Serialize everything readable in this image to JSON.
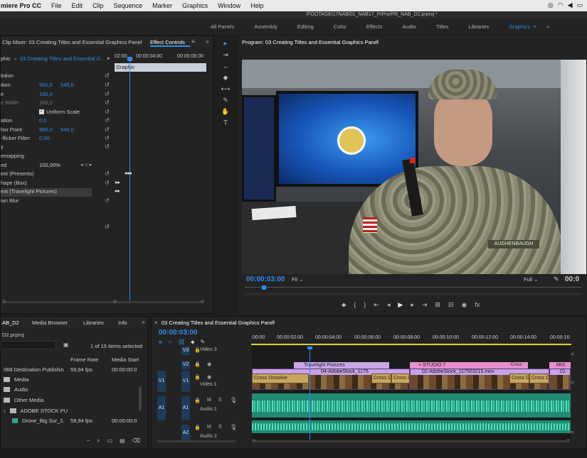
{
  "menubar": {
    "app_name": "miere Pro CC",
    "items": [
      "File",
      "Edit",
      "Clip",
      "Sequence",
      "Marker",
      "Graphics",
      "Window",
      "Help"
    ]
  },
  "window_title": "/FOOTAGE/17NAB/01_NAB17_PrPro/PR_NAB_D2.prproj *",
  "workspaces": {
    "items": [
      "All Panels",
      "Assembly",
      "Editing",
      "Color",
      "Effects",
      "Audio",
      "Titles",
      "Libraries",
      "Graphics"
    ],
    "active": "Graphics",
    "more": "»"
  },
  "effect_controls": {
    "tab_clip_mixer": "Clip Mixer: 03 Creating Titles and Essential Graphics Panel",
    "tab_effect_controls": "Effect Controls",
    "source_prefix": "phic",
    "sequence_name": "03 Creating Titles and Essential G...",
    "time_start": "02:00",
    "time_mid": "00:00:04:00",
    "time_end": "00:00:06:00",
    "graphic_label": "Graphic",
    "rows": [
      {
        "label": "lotion",
        "v1": "",
        "v2": ""
      },
      {
        "label": "ition",
        "v1": "960,0",
        "v2": "540,0"
      },
      {
        "label": "e",
        "v1": "100,0",
        "v2": ""
      },
      {
        "label": "e Width",
        "v1": "100,0",
        "v2": ""
      },
      {
        "label": "",
        "v1": "",
        "v2": ""
      },
      {
        "label": "ation",
        "v1": "0,0",
        "v2": ""
      },
      {
        "label": "hor Point",
        "v1": "960,0",
        "v2": "540,0"
      },
      {
        "label": "-flicker Filter",
        "v1": "0,00",
        "v2": ""
      },
      {
        "label": "y",
        "v1": "",
        "v2": ""
      },
      {
        "label": "emapping",
        "v1": "",
        "v2": ""
      },
      {
        "label": "ed",
        "v1": "100,00%",
        "v2": ""
      },
      {
        "label": "ext (Presents)",
        "v1": "",
        "v2": ""
      },
      {
        "label": "hape (Box)",
        "v1": "",
        "v2": ""
      },
      {
        "label": "ext (Travelight Pictures)",
        "v1": "",
        "v2": ""
      },
      {
        "label": "ian Blur",
        "v1": "",
        "v2": ""
      }
    ],
    "uniform_scale": "Uniform Scale"
  },
  "program_monitor": {
    "title": "Program: 03 Creating Titles and Essential Graphics Panel",
    "timecode": "00:00:03:00",
    "fit": "Fit",
    "quality": "Full",
    "timecode_right": "00:0"
  },
  "project": {
    "tabs": [
      "AB_D2",
      "Media Browser",
      "Libraries",
      "Info"
    ],
    "file_name": "D2.prproj",
    "items_selected": "1 of 15 items selected",
    "col_frame_rate": "Frame Rate",
    "col_media_start": "Media Start",
    "items": [
      {
        "name": "068 Destination Publishin",
        "rate": "59,94 fps",
        "start": "00:00:00:0"
      },
      {
        "name": "Media",
        "rate": "",
        "start": ""
      },
      {
        "name": "Audio",
        "rate": "",
        "start": ""
      },
      {
        "name": "Other Media",
        "rate": "",
        "start": ""
      },
      {
        "name": "ADOBE STOCK PU",
        "rate": "",
        "start": ""
      },
      {
        "name": "Drone_Big Sur_2.",
        "rate": "59,94 fps",
        "start": "00:00:00:0"
      }
    ]
  },
  "timeline": {
    "title": "03 Creating Titles and Essential Graphics Panel",
    "timecode": "00:00:03:00",
    "ruler": [
      ":00:00",
      "00:00:02:00",
      "00:00:04:00",
      "00:00:06:00",
      "00:00:08:00",
      "00:00:10:00",
      "00:00:12:00",
      "00:00:14:00",
      "00:00:16:"
    ],
    "tracks": {
      "v3": "V3",
      "v3_name": "Video 3",
      "v2": "V2",
      "v1": "V1",
      "v1_name": "Video 1",
      "a1": "A1",
      "a1_name": "Audio 1",
      "a2": "A2",
      "a2_name": "Audio 2"
    },
    "clips": {
      "travelight": "Travelight Pictures",
      "stock1175": "04-AdobeStock_1175",
      "studio7": "+ STUDIO 7",
      "stock117": "02-AdobeStock_117503215.mov",
      "mis": "MIS",
      "o1": "01-",
      "cross1": "Cross Dissolve",
      "cross2": "Cross D",
      "cross3": "Cross D",
      "cross4": "Cross D",
      "cross5": "Cross D",
      "cross6": "Cross",
      "cross7": "Cross"
    }
  },
  "colors": {
    "accent": "#2d8ceb",
    "purple_clip": "#c7a2e8",
    "pink_clip": "#e88fd0",
    "audio": "#2aa58a",
    "transition": "#c7a55e"
  }
}
